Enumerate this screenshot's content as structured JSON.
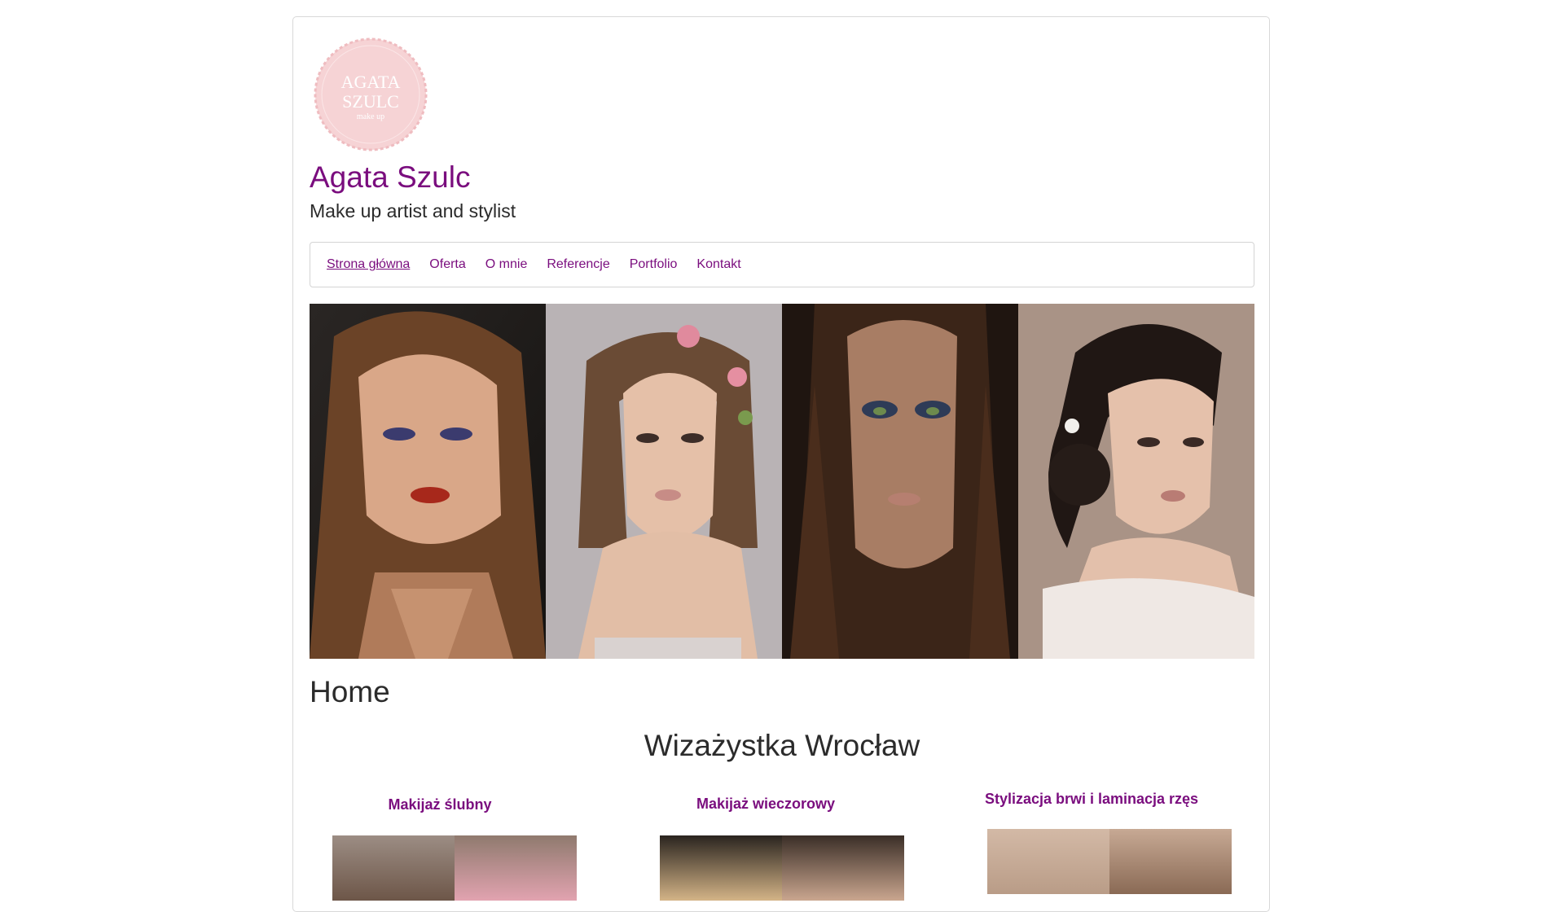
{
  "site": {
    "logo_text_line1": "AGATA",
    "logo_text_line2": "SZULC",
    "logo_text_line3": "make up",
    "title": "Agata Szulc",
    "tagline": "Make up artist and stylist"
  },
  "nav": {
    "items": [
      {
        "label": "Strona główna",
        "active": true
      },
      {
        "label": "Oferta"
      },
      {
        "label": "O mnie"
      },
      {
        "label": "Referencje"
      },
      {
        "label": "Portfolio"
      },
      {
        "label": "Kontakt"
      }
    ]
  },
  "main": {
    "page_heading": "Home",
    "section_heading": "Wizażystka Wrocław",
    "services": [
      {
        "title": "Makijaż ślubny"
      },
      {
        "title": "Makijaż wieczorowy"
      },
      {
        "title": "Stylizacja brwi i laminacja rzęs"
      }
    ]
  },
  "colors": {
    "accent": "#7a0d7e",
    "logo_pink": "#f6d3d5",
    "border": "#d4d4d4"
  }
}
